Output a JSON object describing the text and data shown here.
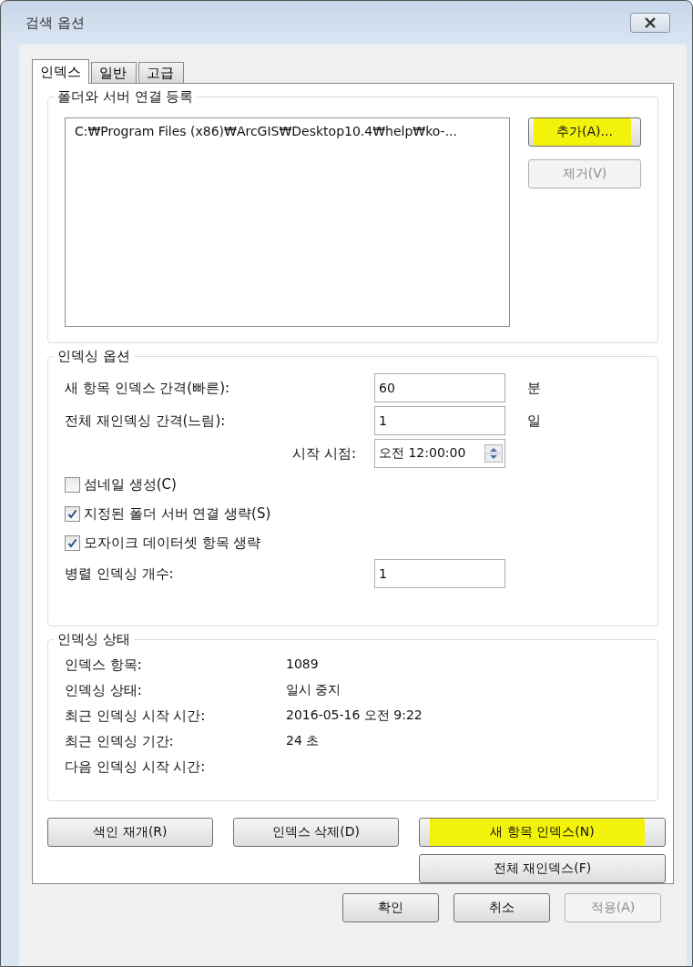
{
  "window": {
    "title": "검색 옵션"
  },
  "tabs": [
    {
      "label": "인덱스",
      "selected": true
    },
    {
      "label": "일반",
      "selected": false
    },
    {
      "label": "고급",
      "selected": false
    }
  ],
  "folder_group": {
    "title": "폴더와 서버 연결 등록",
    "list_items": [
      "C:₩Program Files (x86)₩ArcGIS₩Desktop10.4₩help₩ko-..."
    ],
    "buttons": [
      {
        "label": "추가(A)...",
        "disabled": false,
        "highlighted": true
      },
      {
        "label": "제거(V)",
        "disabled": true,
        "highlighted": false
      }
    ]
  },
  "options_group": {
    "title": "인덱싱 옵션",
    "items": [
      {
        "kind": "field",
        "label": "새 항목 인덱스 간격(빠른):",
        "value": "60",
        "unit": "분"
      },
      {
        "kind": "field",
        "label": "전체 재인덱싱 간격(느림):",
        "value": "1",
        "unit": "일"
      },
      {
        "kind": "time",
        "label": "시작 시점:",
        "value": "오전 12:00:00"
      },
      {
        "kind": "checkbox",
        "label": "섬네일 생성(C)",
        "checked": false
      },
      {
        "kind": "checkbox",
        "label": "지정된 폴더 서버 연결 생략(S)",
        "checked": true
      },
      {
        "kind": "checkbox",
        "label": "모자이크 데이터셋 항목 생략",
        "checked": true
      },
      {
        "kind": "field",
        "label": "병렬 인덱싱 개수:",
        "value": "1"
      }
    ]
  },
  "status_group": {
    "title": "인덱싱 상태",
    "rows": [
      {
        "label": "인덱스 항목:",
        "value": "1089"
      },
      {
        "label": "인덱싱 상태:",
        "value": "일시 중지"
      },
      {
        "label": "최근 인덱싱 시작 시간:",
        "value": "2016-05-16 오전 9:22"
      },
      {
        "label": "최근 인덱싱 기간:",
        "value": "24 초"
      },
      {
        "label": "다음 인덱싱 시작 시간:"
      }
    ]
  },
  "action_buttons": [
    {
      "label": "색인 재개(R)",
      "highlighted": false
    },
    {
      "label": "인덱스 삭제(D)",
      "highlighted": false
    },
    {
      "label": "새 항목 인덱스(N)",
      "highlighted": true
    },
    {
      "label": "전체 재인덱스(F)",
      "highlighted": false
    }
  ],
  "footer_buttons": [
    {
      "label": "확인",
      "disabled": false
    },
    {
      "label": "취소",
      "disabled": false
    },
    {
      "label": "적용(A)",
      "disabled": true
    }
  ]
}
